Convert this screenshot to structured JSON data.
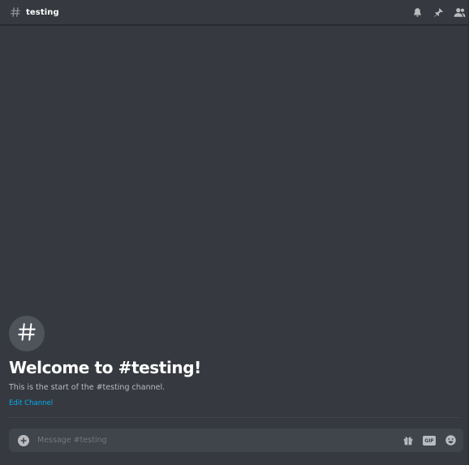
{
  "header": {
    "channel_name": "testing",
    "icons": [
      "hash-icon",
      "bell-icon",
      "pin-icon",
      "members-icon"
    ]
  },
  "welcome": {
    "title": "Welcome to #testing!",
    "description": "This is the start of the #testing channel.",
    "edit_link": "Edit Channel"
  },
  "composer": {
    "placeholder": "Message #testing",
    "value": "",
    "gif_label": "GIF",
    "icons": [
      "add-circle-icon",
      "gift-icon",
      "gif-icon",
      "emoji-icon"
    ]
  },
  "colors": {
    "background": "#36393f",
    "input_bg": "#40444b",
    "link": "#00b0f4",
    "icon": "#b9bbbe"
  }
}
